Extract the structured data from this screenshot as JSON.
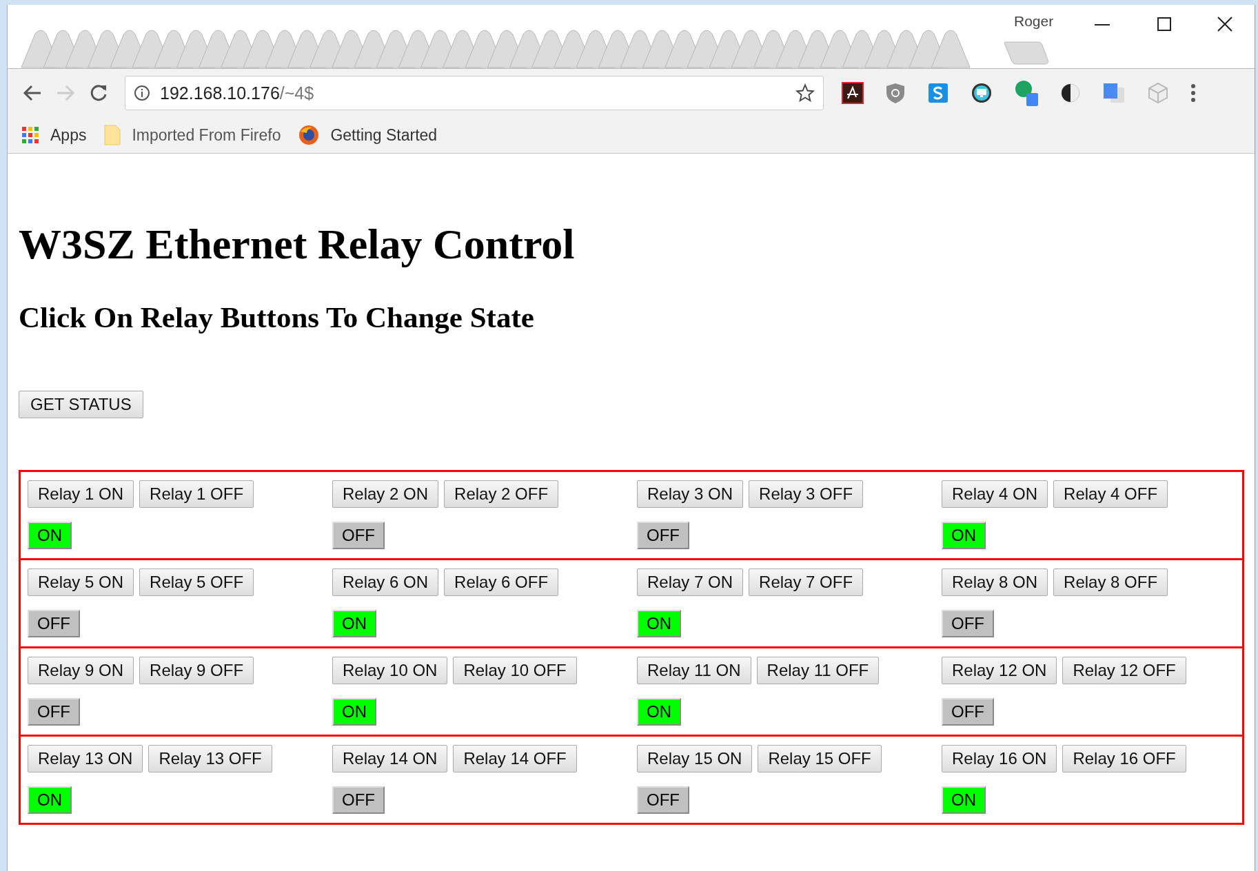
{
  "browser": {
    "profile": "Roger",
    "url": {
      "host": "192.168.10.176",
      "path": "/~4$"
    },
    "bookmarks": [
      {
        "kind": "apps",
        "label": "Apps"
      },
      {
        "kind": "folder",
        "label": "Imported From Firefo"
      },
      {
        "kind": "firefox",
        "label": "Getting Started"
      }
    ]
  },
  "page": {
    "title": "W3SZ Ethernet Relay Control",
    "subtitle": "Click On Relay Buttons To Change State",
    "status_button": "GET STATUS",
    "relays": [
      {
        "on_button": "Relay 1 ON",
        "off_button": "Relay 1 OFF",
        "status": "ON",
        "on": true
      },
      {
        "on_button": "Relay 2 ON",
        "off_button": "Relay 2 OFF",
        "status": "OFF",
        "on": false
      },
      {
        "on_button": "Relay 3 ON",
        "off_button": "Relay 3 OFF",
        "status": "OFF",
        "on": false
      },
      {
        "on_button": "Relay 4 ON",
        "off_button": "Relay 4 OFF",
        "status": "ON",
        "on": true
      },
      {
        "on_button": "Relay 5 ON",
        "off_button": "Relay 5 OFF",
        "status": "OFF",
        "on": false
      },
      {
        "on_button": "Relay 6 ON",
        "off_button": "Relay 6 OFF",
        "status": "ON",
        "on": true
      },
      {
        "on_button": "Relay 7 ON",
        "off_button": "Relay 7 OFF",
        "status": "ON",
        "on": true
      },
      {
        "on_button": "Relay 8 ON",
        "off_button": "Relay 8 OFF",
        "status": "OFF",
        "on": false
      },
      {
        "on_button": "Relay 9 ON",
        "off_button": "Relay 9 OFF",
        "status": "OFF",
        "on": false
      },
      {
        "on_button": "Relay 10 ON",
        "off_button": "Relay 10 OFF",
        "status": "ON",
        "on": true
      },
      {
        "on_button": "Relay 11 ON",
        "off_button": "Relay 11 OFF",
        "status": "ON",
        "on": true
      },
      {
        "on_button": "Relay 12 ON",
        "off_button": "Relay 12 OFF",
        "status": "OFF",
        "on": false
      },
      {
        "on_button": "Relay 13 ON",
        "off_button": "Relay 13 OFF",
        "status": "ON",
        "on": true
      },
      {
        "on_button": "Relay 14 ON",
        "off_button": "Relay 14 OFF",
        "status": "OFF",
        "on": false
      },
      {
        "on_button": "Relay 15 ON",
        "off_button": "Relay 15 OFF",
        "status": "OFF",
        "on": false
      },
      {
        "on_button": "Relay 16 ON",
        "off_button": "Relay 16 OFF",
        "status": "ON",
        "on": true
      }
    ]
  }
}
